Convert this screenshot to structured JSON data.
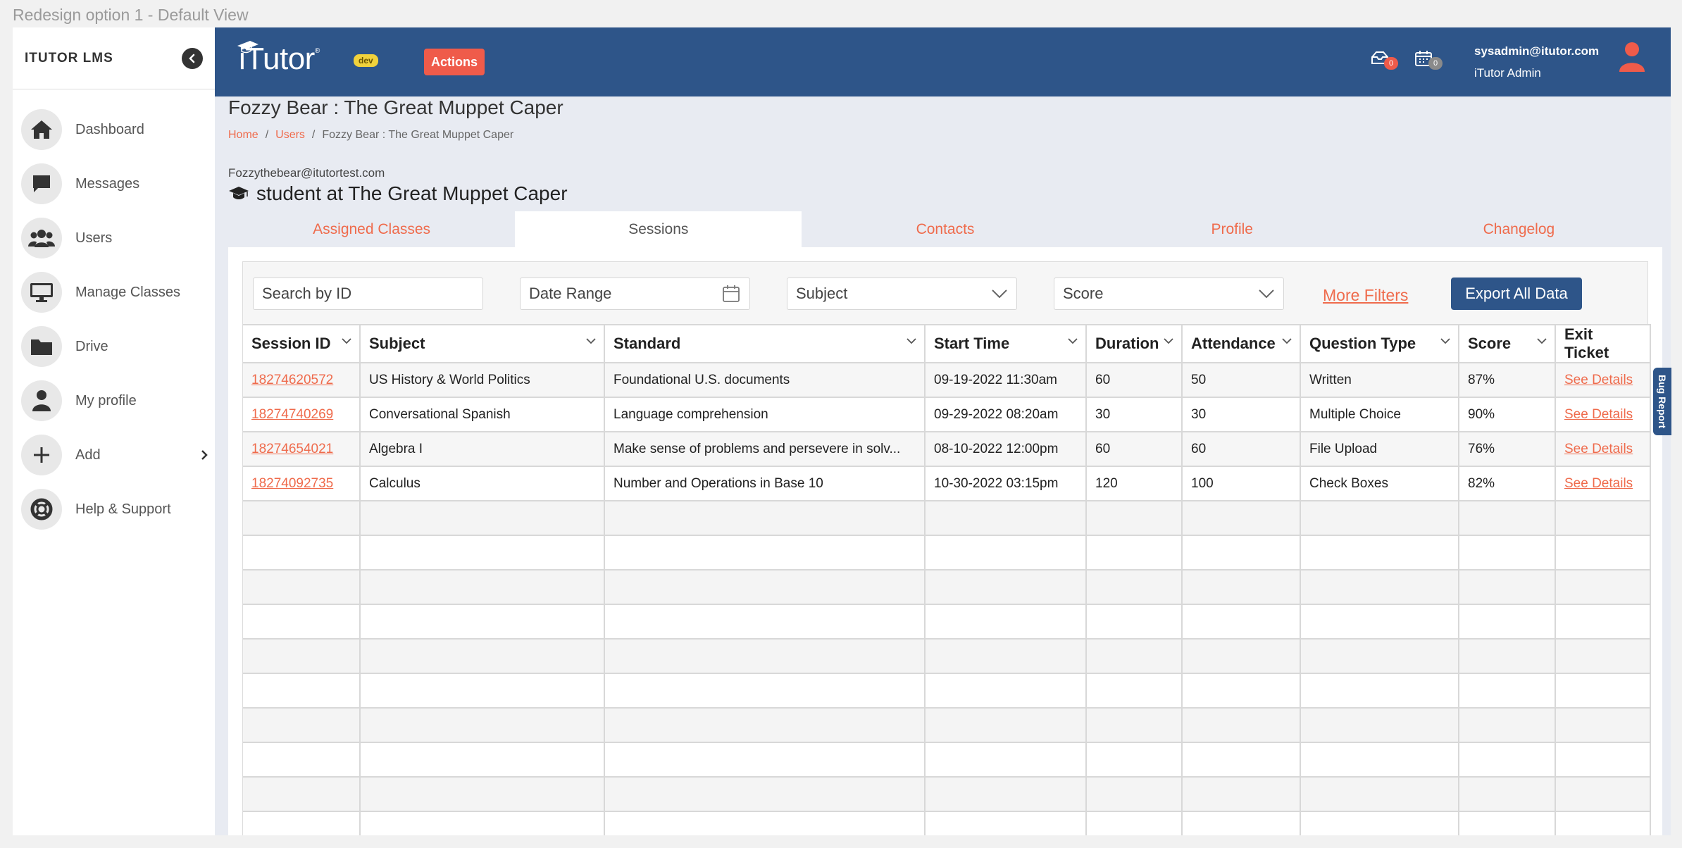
{
  "frame_label": "Redesign option 1 - Default View",
  "sidebar": {
    "title": "ITUTOR LMS",
    "items": [
      {
        "label": "Dashboard",
        "icon": "home-icon"
      },
      {
        "label": "Messages",
        "icon": "chat-icon"
      },
      {
        "label": "Users",
        "icon": "users-icon"
      },
      {
        "label": "Manage Classes",
        "icon": "monitor-icon"
      },
      {
        "label": "Drive",
        "icon": "folder-icon"
      },
      {
        "label": "My profile",
        "icon": "person-icon"
      },
      {
        "label": "Add",
        "icon": "plus-icon"
      },
      {
        "label": "Help & Support",
        "icon": "lifebuoy-icon"
      }
    ]
  },
  "header": {
    "logo_text": "iTutor",
    "logo_mark": "®",
    "env_badge": "dev",
    "actions_label": "Actions",
    "inbox_count": "0",
    "calendar_count": "0",
    "user_email": "sysadmin@itutor.com",
    "user_role": "iTutor Admin"
  },
  "page": {
    "title": "Fozzy Bear : The Great Muppet Caper",
    "breadcrumb": [
      "Home",
      "Users",
      "Fozzy Bear : The Great Muppet Caper"
    ],
    "email": "Fozzythebear@itutortest.com",
    "role_line": "student at The Great Muppet Caper"
  },
  "tabs": [
    {
      "label": "Assigned Classes",
      "active": false
    },
    {
      "label": "Sessions",
      "active": true
    },
    {
      "label": "Contacts",
      "active": false
    },
    {
      "label": "Profile",
      "active": false
    },
    {
      "label": "Changelog",
      "active": false
    }
  ],
  "filters": {
    "search_placeholder": "Search by ID",
    "date_range": "Date Range",
    "subject": "Subject",
    "score": "Score",
    "more_filters": "More Filters",
    "export": "Export All Data"
  },
  "table": {
    "columns": [
      "Session ID",
      "Subject",
      "Standard",
      "Start Time",
      "Duration",
      "Attendance",
      "Question Type",
      "Score",
      "Exit Ticket"
    ],
    "rows": [
      {
        "id": "18274620572",
        "subject": "US History & World Politics",
        "standard": "Foundational U.S. documents",
        "start": "09-19-2022 11:30am",
        "duration": "60",
        "attendance": "50",
        "qtype": "Written",
        "score": "87%",
        "ticket": "See Details"
      },
      {
        "id": "18274740269",
        "subject": "Conversational Spanish",
        "standard": "Language comprehension",
        "start": "09-29-2022 08:20am",
        "duration": "30",
        "attendance": "30",
        "qtype": "Multiple Choice",
        "score": "90%",
        "ticket": "See Details"
      },
      {
        "id": "18274654021",
        "subject": "Algebra I",
        "standard": "Make sense of problems and persevere in solv...",
        "start": "08-10-2022 12:00pm",
        "duration": "60",
        "attendance": "60",
        "qtype": "File Upload",
        "score": "76%",
        "ticket": "See Details"
      },
      {
        "id": "18274092735",
        "subject": "Calculus",
        "standard": "Number and Operations in Base 10",
        "start": "10-30-2022 03:15pm",
        "duration": "120",
        "attendance": "100",
        "qtype": "Check Boxes",
        "score": "82%",
        "ticket": "See Details"
      }
    ]
  },
  "bug_report": "Bug Report",
  "colors": {
    "primary": "#2e5589",
    "accent": "#ef6b4c",
    "badge_red": "#ef5b4a"
  }
}
